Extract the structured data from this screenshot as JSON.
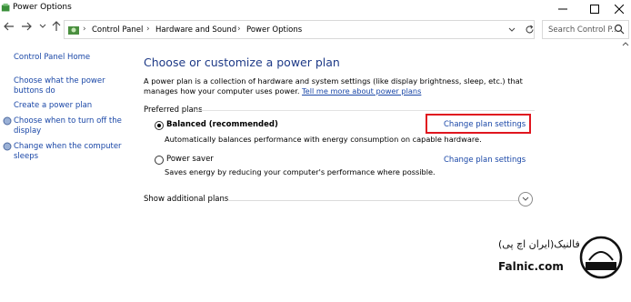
{
  "window": {
    "title": "Power Options",
    "controls": [
      "minimize",
      "maximize",
      "close"
    ]
  },
  "address_bar": {
    "crumbs": [
      "Control Panel",
      "Hardware and Sound",
      "Power Options"
    ]
  },
  "search": {
    "placeholder": "Search Control P..."
  },
  "sidebar": {
    "home": "Control Panel Home",
    "items": [
      {
        "label_1": "Choose what the power",
        "label_2": "buttons do"
      },
      {
        "label_1": "Create a power plan",
        "label_2": ""
      },
      {
        "label_1": "Choose when to turn off the",
        "label_2": "display"
      },
      {
        "label_1": "Change when the computer",
        "label_2": "sleeps"
      }
    ]
  },
  "main": {
    "heading": "Choose or customize a power plan",
    "intro_line1": "A power plan is a collection of hardware and system settings (like display brightness, sleep, etc.) that manages",
    "intro_line2": "how your computer uses power.",
    "intro_link": "Tell me more about power plans",
    "section_label": "Preferred plans",
    "plans": [
      {
        "name": "Balanced (recommended)",
        "selected": true,
        "description": "Automatically balances performance with energy consumption on capable hardware.",
        "link": "Change plan settings"
      },
      {
        "name": "Power saver",
        "selected": false,
        "description": "Saves energy by reducing your computer's performance where possible.",
        "link": "Change plan settings"
      }
    ],
    "show_more": "Show additional plans"
  },
  "highlight_color": "#e0161f",
  "link_color": "#1a47a7",
  "heading_color": "#1e3a87",
  "watermark": {
    "persian": "فالنیک(ایران اچ پی)",
    "english": "Falnic.com"
  }
}
